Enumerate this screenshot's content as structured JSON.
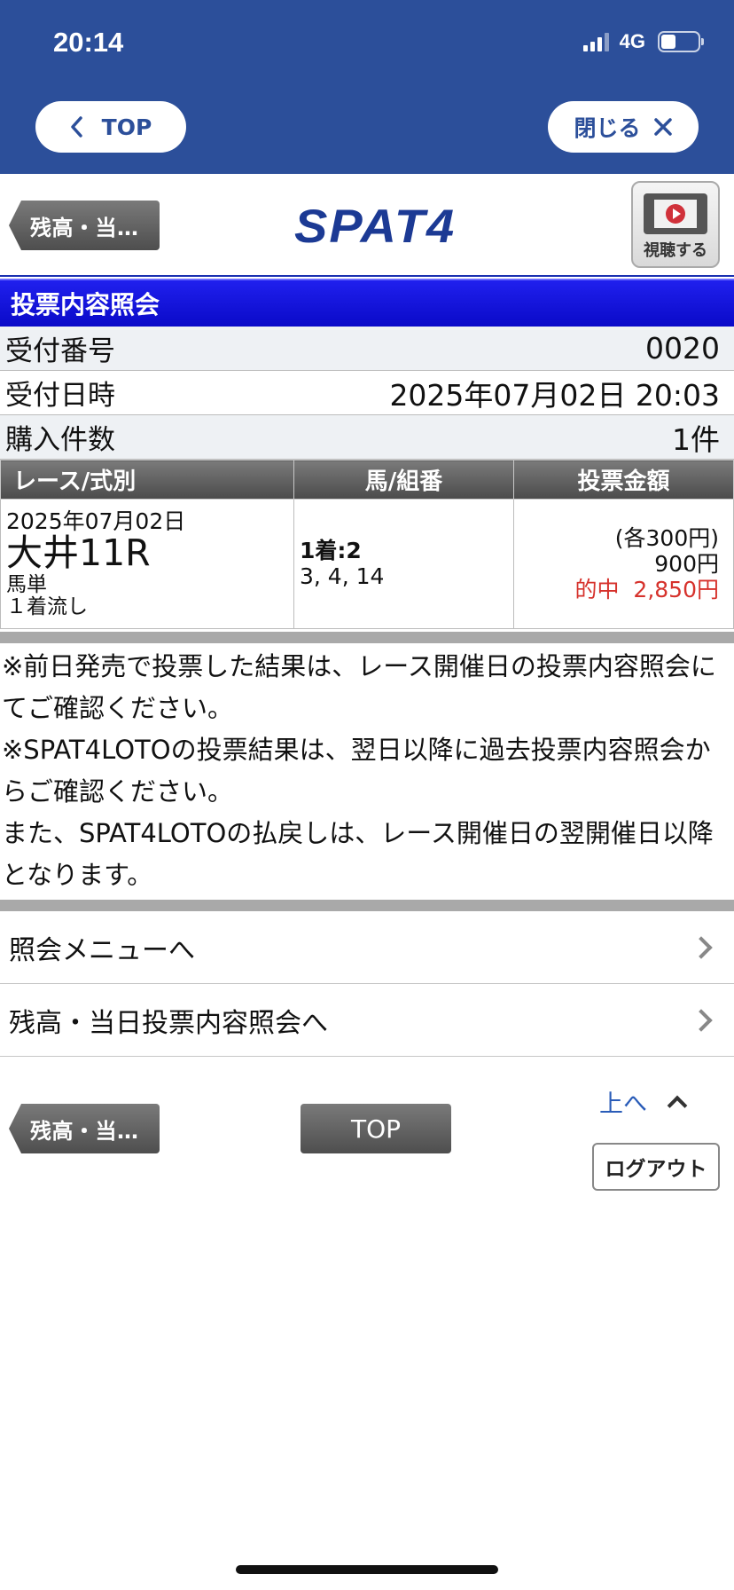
{
  "status_bar": {
    "time": "20:14",
    "network": "4G"
  },
  "browser_header": {
    "top_label": "TOP",
    "close_label": "閉じる"
  },
  "app_header": {
    "back_label": "残高・当…",
    "logo": "SPAT4",
    "watch_label": "視聴する"
  },
  "section_title": "投票内容照会",
  "info": [
    {
      "label": "受付番号",
      "value": "0020"
    },
    {
      "label": "受付日時",
      "value": "2025年07月02日 20:03"
    },
    {
      "label": "購入件数",
      "value": "1件"
    }
  ],
  "table": {
    "headers": [
      "レース/式別",
      "馬/組番",
      "投票金額"
    ],
    "row": {
      "race_date": "2025年07月02日",
      "race_name": "大井11R",
      "bet_type": "馬単",
      "bet_method": "１着流し",
      "horse_first": "1着:2",
      "horse_rest": "3, 4, 14",
      "amount_each": "(各300円)",
      "amount_total": "900円",
      "hit": "的中  2,850円"
    }
  },
  "notes": [
    "※前日発売で投票した結果は、レース開催日の投票内容照会にてご確認ください。",
    "※SPAT4LOTOの投票結果は、翌日以降に過去投票内容照会からご確認ください。",
    "また、SPAT4LOTOの払戻しは、レース開催日の翌開催日以降となります。"
  ],
  "menu": [
    {
      "label": "照会メニューへ"
    },
    {
      "label": "残高・当日投票内容照会へ"
    }
  ],
  "footer": {
    "back_label": "残高・当…",
    "top_label": "TOP",
    "up_label": "上へ",
    "logout_label": "ログアウト"
  },
  "colors": {
    "header_blue": "#2c4f9a",
    "section_blue": "#0a0ac8",
    "hit_red": "#d6322c",
    "link_blue": "#2a5cb8"
  }
}
